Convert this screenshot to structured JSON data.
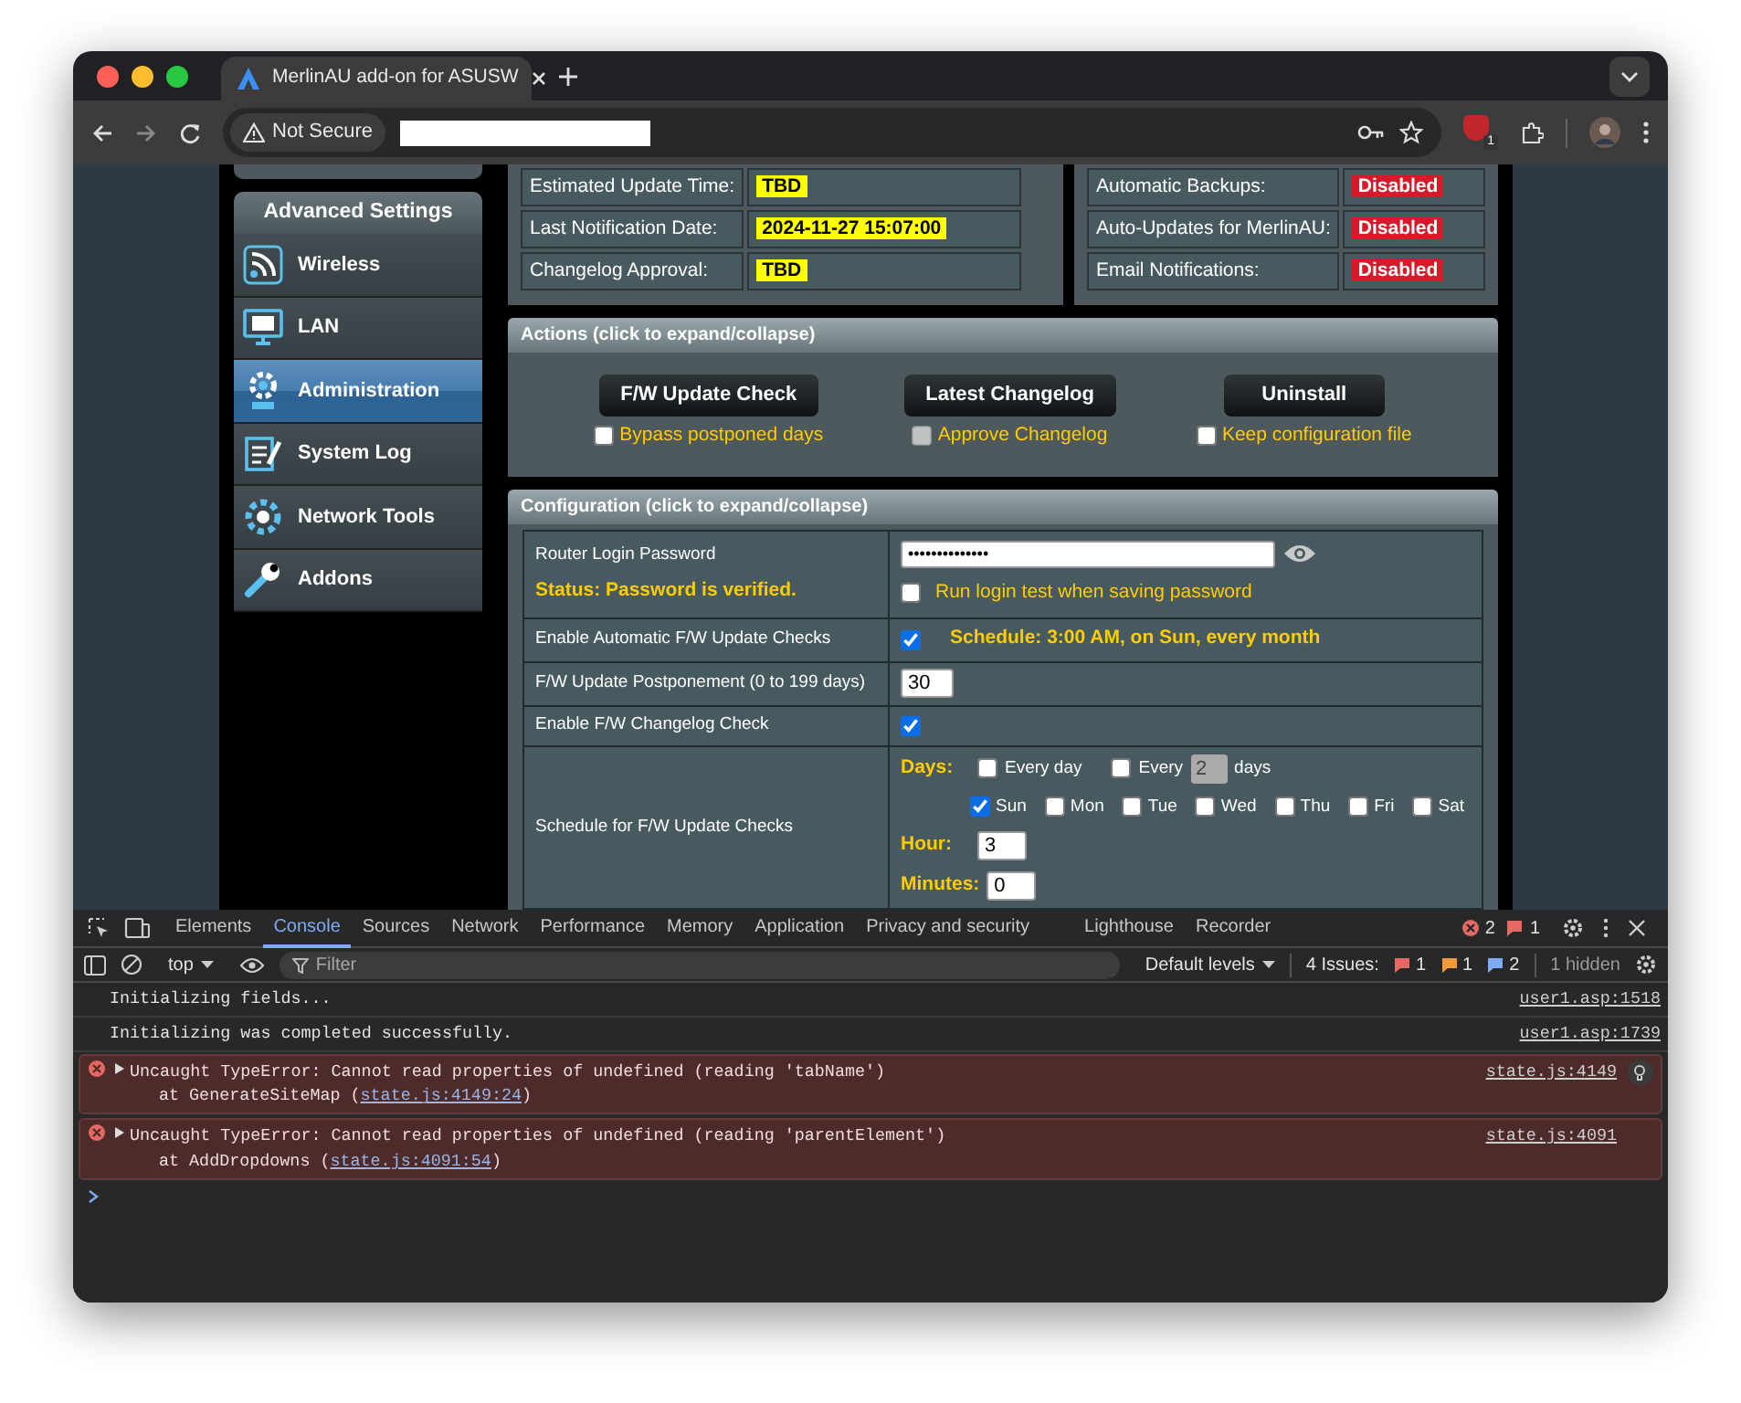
{
  "browser": {
    "tab_title": "MerlinAU add-on for ASUSW",
    "security_label": "Not Secure",
    "extension_badge": "1"
  },
  "sidebar": {
    "heading": "Advanced Settings",
    "items": [
      {
        "label": "Wireless",
        "selected": false
      },
      {
        "label": "LAN",
        "selected": false
      },
      {
        "label": "Administration",
        "selected": true
      },
      {
        "label": "System Log",
        "selected": false
      },
      {
        "label": "Network Tools",
        "selected": false
      },
      {
        "label": "Addons",
        "selected": false
      }
    ]
  },
  "status_tables": [
    {
      "rows": [
        {
          "label": "Estimated Update Time:",
          "value": "TBD",
          "kind": "highlight"
        },
        {
          "label": "Last Notification Date:",
          "value": "2024-11-27 15:07:00",
          "kind": "highlight"
        },
        {
          "label": "Changelog Approval:",
          "value": "TBD",
          "kind": "highlight"
        }
      ]
    },
    {
      "rows": [
        {
          "label": "Automatic Backups:",
          "value": "Disabled",
          "kind": "alert"
        },
        {
          "label": "Auto-Updates for MerlinAU:",
          "value": "Disabled",
          "kind": "alert"
        },
        {
          "label": "Email Notifications:",
          "value": "Disabled",
          "kind": "alert"
        }
      ]
    }
  ],
  "actions": {
    "title": "Actions (click to expand/collapse)",
    "buttons": [
      {
        "label": "F/W Update Check",
        "option": {
          "label": "Bypass postponed days",
          "checked": false,
          "disabled": false
        }
      },
      {
        "label": "Latest Changelog",
        "option": {
          "label": "Approve Changelog",
          "checked": false,
          "disabled": true
        }
      },
      {
        "label": "Uninstall",
        "option": {
          "label": "Keep configuration file",
          "checked": false,
          "disabled": false
        }
      }
    ]
  },
  "configuration": {
    "title": "Configuration (click to expand/collapse)",
    "rows": [
      {
        "kind": "password",
        "label": "Router Login Password",
        "status": "Status: Password is verified.",
        "value": "••••••••••••••",
        "option": {
          "label": "Run login test when saving password",
          "checked": false
        }
      },
      {
        "kind": "toggle",
        "label": "Enable Automatic F/W Update Checks",
        "checked": true,
        "note": "Schedule: 3:00 AM, on Sun, every month"
      },
      {
        "kind": "number",
        "label": "F/W Update Postponement (0 to 199 days)",
        "value": "30"
      },
      {
        "kind": "toggle",
        "label": "Enable F/W Changelog Check",
        "checked": true
      },
      {
        "kind": "schedule",
        "label": "Schedule for F/W Update Checks",
        "days_label": "Days:",
        "every_day": {
          "label": "Every day",
          "checked": false
        },
        "every_n": {
          "label": "Every",
          "value": "2",
          "unit": "days",
          "checked": false,
          "disabled": true
        },
        "weekdays": [
          {
            "label": "Sun",
            "checked": true
          },
          {
            "label": "Mon",
            "checked": false
          },
          {
            "label": "Tue",
            "checked": false
          },
          {
            "label": "Wed",
            "checked": false
          },
          {
            "label": "Thu",
            "checked": false
          },
          {
            "label": "Fri",
            "checked": false
          },
          {
            "label": "Sat",
            "checked": false
          }
        ],
        "hour_label": "Hour:",
        "hour": "3",
        "minutes_label": "Minutes:",
        "minutes": "0"
      }
    ]
  },
  "devtools": {
    "tabs": [
      {
        "label": "Elements",
        "selected": false
      },
      {
        "label": "Console",
        "selected": true
      },
      {
        "label": "Sources",
        "selected": false
      },
      {
        "label": "Network",
        "selected": false
      },
      {
        "label": "Performance",
        "selected": false
      },
      {
        "label": "Memory",
        "selected": false
      },
      {
        "label": "Application",
        "selected": false
      },
      {
        "label": "Privacy and security",
        "selected": false
      },
      {
        "label": "Lighthouse",
        "selected": false
      },
      {
        "label": "Recorder",
        "selected": false
      }
    ],
    "error_count": "2",
    "warning_count": "1",
    "context": "top",
    "filter_placeholder": "Filter",
    "levels": "Default levels",
    "issues_label": "4 Issues:",
    "issue_counts": [
      "1",
      "1",
      "2"
    ],
    "hidden": "1 hidden",
    "messages": [
      {
        "kind": "log",
        "text": "Initializing fields...",
        "source": "user1.asp:1518"
      },
      {
        "kind": "log",
        "text": "Initializing was completed successfully.",
        "source": "user1.asp:1739"
      },
      {
        "kind": "error",
        "text": "Uncaught TypeError: Cannot read properties of undefined (reading 'tabName')",
        "stack_prefix": "at GenerateSiteMap (",
        "stack_link": "state.js:4149:24",
        "stack_suffix": ")",
        "source": "state.js:4149"
      },
      {
        "kind": "error",
        "text": "Uncaught TypeError: Cannot read properties of undefined (reading 'parentElement')",
        "stack_prefix": "at AddDropdowns (",
        "stack_link": "state.js:4091:54",
        "stack_suffix": ")",
        "source": "state.js:4091"
      }
    ]
  }
}
